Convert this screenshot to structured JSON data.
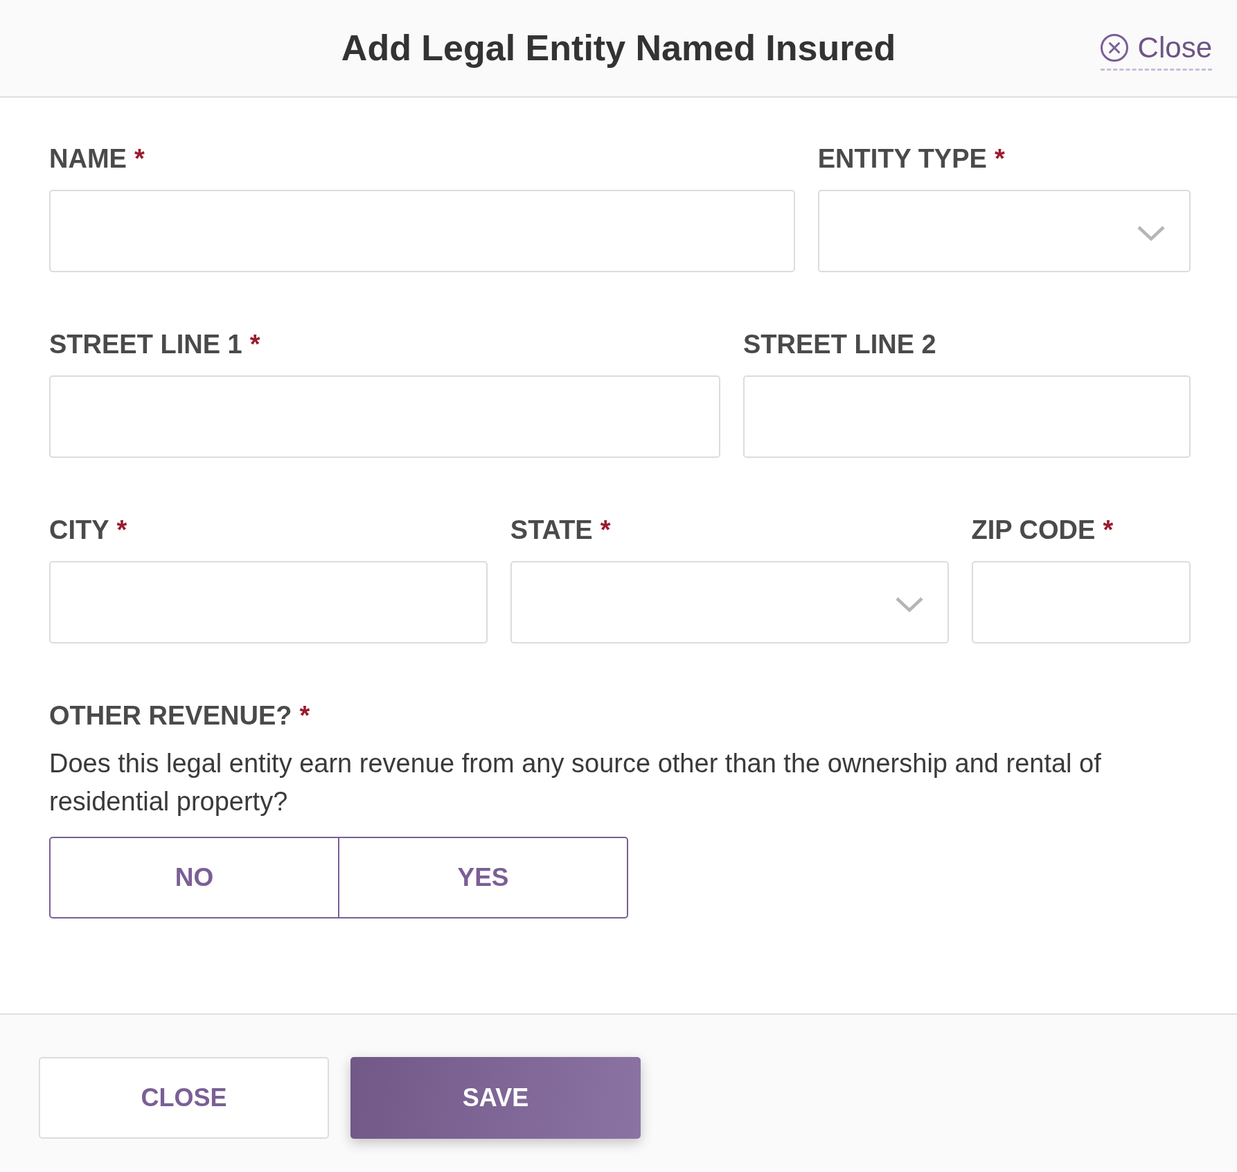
{
  "header": {
    "title": "Add Legal Entity Named Insured",
    "close_link": "Close"
  },
  "form": {
    "rows": [
      {
        "fields": [
          {
            "label": "NAME",
            "required_mark": "*",
            "kind": "text"
          },
          {
            "label": "ENTITY TYPE",
            "required_mark": "*",
            "kind": "select"
          }
        ]
      },
      {
        "fields": [
          {
            "label": "STREET LINE 1",
            "required_mark": "*",
            "kind": "text"
          },
          {
            "label": "STREET LINE 2",
            "kind": "text"
          }
        ]
      },
      {
        "fields": [
          {
            "label": "CITY",
            "required_mark": "*",
            "kind": "text"
          },
          {
            "label": "STATE",
            "required_mark": "*",
            "kind": "select"
          },
          {
            "label": "ZIP CODE",
            "required_mark": "*",
            "kind": "text"
          }
        ]
      }
    ],
    "other_revenue": {
      "label": "OTHER REVENUE?",
      "required_mark": "*",
      "question": "Does this legal entity earn revenue from any source other than the ownership and rental of residential property?",
      "options": [
        {
          "label": "NO",
          "selected": false
        },
        {
          "label": "YES",
          "selected": false
        }
      ]
    }
  },
  "footer": {
    "buttons": [
      {
        "label": "CLOSE",
        "kind": "secondary"
      },
      {
        "label": "SAVE",
        "kind": "primary"
      }
    ]
  }
}
